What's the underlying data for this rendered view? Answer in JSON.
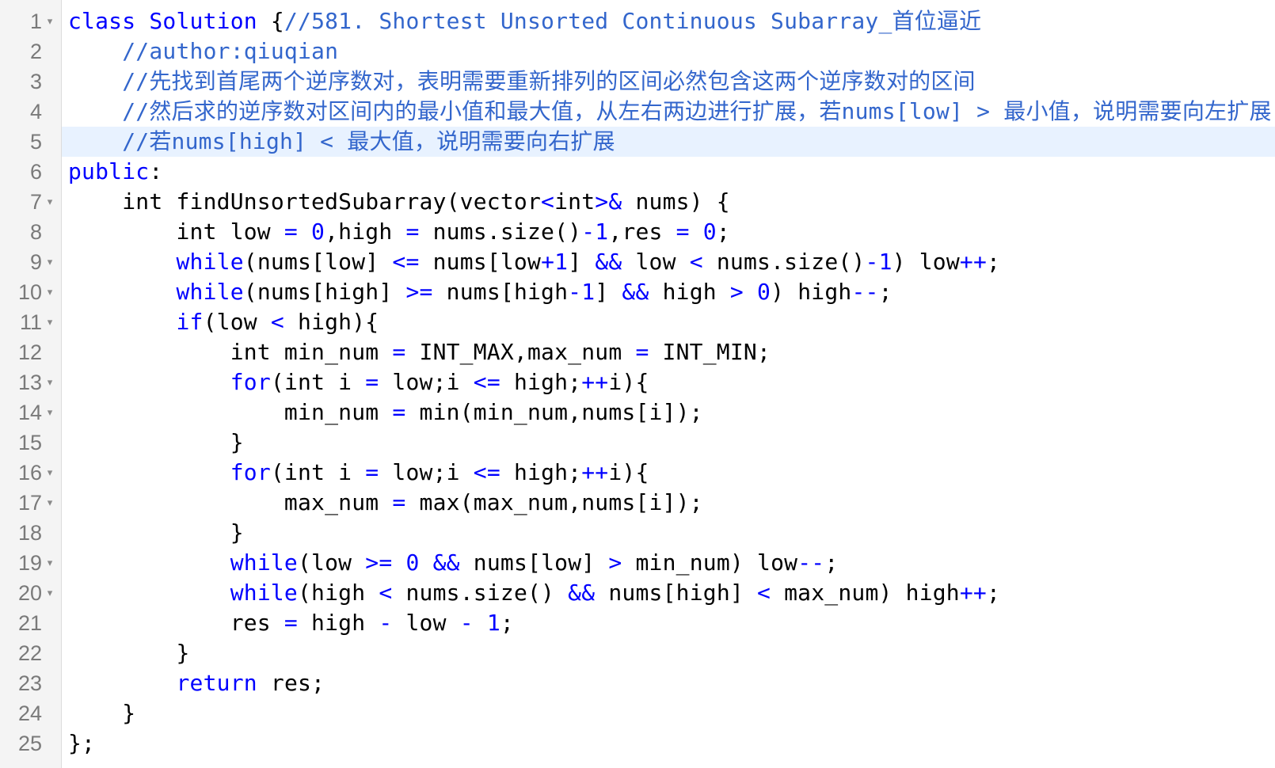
{
  "editor": {
    "active_line": 5,
    "fold_lines": [
      1,
      7,
      9,
      10,
      11,
      13,
      14,
      16,
      17,
      19,
      20
    ],
    "lines": [
      [
        [
          "kw",
          "class "
        ],
        [
          "kw",
          "Solution "
        ],
        [
          "t",
          "{"
        ],
        [
          "cm",
          "//581. Shortest Unsorted Continuous Subarray_首位逼近"
        ]
      ],
      [
        [
          "t",
          "    "
        ],
        [
          "cm",
          "//author:qiuqian"
        ]
      ],
      [
        [
          "t",
          "    "
        ],
        [
          "cm",
          "//先找到首尾两个逆序数对，表明需要重新排列的区间必然包含这两个逆序数对的区间"
        ]
      ],
      [
        [
          "t",
          "    "
        ],
        [
          "cm",
          "//然后求的逆序数对区间内的最小值和最大值，从左右两边进行扩展，若nums[low] > 最小值，说明需要向左扩展"
        ]
      ],
      [
        [
          "t",
          "    "
        ],
        [
          "cm",
          "//若nums[high] < 最大值，说明需要向右扩展"
        ]
      ],
      [
        [
          "kw",
          "public"
        ],
        [
          "t",
          ":"
        ]
      ],
      [
        [
          "t",
          "    int findUnsortedSubarray(vector"
        ],
        [
          "op",
          "<"
        ],
        [
          "t",
          "int"
        ],
        [
          "op",
          ">&"
        ],
        [
          "t",
          " nums) {"
        ]
      ],
      [
        [
          "t",
          "        int low "
        ],
        [
          "op",
          "="
        ],
        [
          "t",
          " "
        ],
        [
          "num",
          "0"
        ],
        [
          "t",
          ",high "
        ],
        [
          "op",
          "="
        ],
        [
          "t",
          " nums.size()"
        ],
        [
          "op",
          "-"
        ],
        [
          "num",
          "1"
        ],
        [
          "t",
          ",res "
        ],
        [
          "op",
          "="
        ],
        [
          "t",
          " "
        ],
        [
          "num",
          "0"
        ],
        [
          "t",
          ";"
        ]
      ],
      [
        [
          "t",
          "        "
        ],
        [
          "kw",
          "while"
        ],
        [
          "t",
          "(nums[low] "
        ],
        [
          "op",
          "<="
        ],
        [
          "t",
          " nums[low"
        ],
        [
          "op",
          "+"
        ],
        [
          "num",
          "1"
        ],
        [
          "t",
          "] "
        ],
        [
          "op",
          "&&"
        ],
        [
          "t",
          " low "
        ],
        [
          "op",
          "<"
        ],
        [
          "t",
          " nums.size()"
        ],
        [
          "op",
          "-"
        ],
        [
          "num",
          "1"
        ],
        [
          "t",
          ") low"
        ],
        [
          "op",
          "++"
        ],
        [
          "t",
          ";"
        ]
      ],
      [
        [
          "t",
          "        "
        ],
        [
          "kw",
          "while"
        ],
        [
          "t",
          "(nums[high] "
        ],
        [
          "op",
          ">="
        ],
        [
          "t",
          " nums[high"
        ],
        [
          "op",
          "-"
        ],
        [
          "num",
          "1"
        ],
        [
          "t",
          "] "
        ],
        [
          "op",
          "&&"
        ],
        [
          "t",
          " high "
        ],
        [
          "op",
          ">"
        ],
        [
          "t",
          " "
        ],
        [
          "num",
          "0"
        ],
        [
          "t",
          ") high"
        ],
        [
          "op",
          "--"
        ],
        [
          "t",
          ";"
        ]
      ],
      [
        [
          "t",
          "        "
        ],
        [
          "kw",
          "if"
        ],
        [
          "t",
          "(low "
        ],
        [
          "op",
          "<"
        ],
        [
          "t",
          " high){"
        ]
      ],
      [
        [
          "t",
          "            int min_num "
        ],
        [
          "op",
          "="
        ],
        [
          "t",
          " INT_MAX,max_num "
        ],
        [
          "op",
          "="
        ],
        [
          "t",
          " INT_MIN;"
        ]
      ],
      [
        [
          "t",
          "            "
        ],
        [
          "kw",
          "for"
        ],
        [
          "t",
          "(int i "
        ],
        [
          "op",
          "="
        ],
        [
          "t",
          " low;i "
        ],
        [
          "op",
          "<="
        ],
        [
          "t",
          " high;"
        ],
        [
          "op",
          "++"
        ],
        [
          "t",
          "i){"
        ]
      ],
      [
        [
          "t",
          "                min_num "
        ],
        [
          "op",
          "="
        ],
        [
          "t",
          " min(min_num,nums[i]);"
        ]
      ],
      [
        [
          "t",
          "            }"
        ]
      ],
      [
        [
          "t",
          "            "
        ],
        [
          "kw",
          "for"
        ],
        [
          "t",
          "(int i "
        ],
        [
          "op",
          "="
        ],
        [
          "t",
          " low;i "
        ],
        [
          "op",
          "<="
        ],
        [
          "t",
          " high;"
        ],
        [
          "op",
          "++"
        ],
        [
          "t",
          "i){"
        ]
      ],
      [
        [
          "t",
          "                max_num "
        ],
        [
          "op",
          "="
        ],
        [
          "t",
          " max(max_num,nums[i]);"
        ]
      ],
      [
        [
          "t",
          "            }"
        ]
      ],
      [
        [
          "t",
          "            "
        ],
        [
          "kw",
          "while"
        ],
        [
          "t",
          "(low "
        ],
        [
          "op",
          ">="
        ],
        [
          "t",
          " "
        ],
        [
          "num",
          "0"
        ],
        [
          "t",
          " "
        ],
        [
          "op",
          "&&"
        ],
        [
          "t",
          " nums[low] "
        ],
        [
          "op",
          ">"
        ],
        [
          "t",
          " min_num) low"
        ],
        [
          "op",
          "--"
        ],
        [
          "t",
          ";"
        ]
      ],
      [
        [
          "t",
          "            "
        ],
        [
          "kw",
          "while"
        ],
        [
          "t",
          "(high "
        ],
        [
          "op",
          "<"
        ],
        [
          "t",
          " nums.size() "
        ],
        [
          "op",
          "&&"
        ],
        [
          "t",
          " nums[high] "
        ],
        [
          "op",
          "<"
        ],
        [
          "t",
          " max_num) high"
        ],
        [
          "op",
          "++"
        ],
        [
          "t",
          ";"
        ]
      ],
      [
        [
          "t",
          "            res "
        ],
        [
          "op",
          "="
        ],
        [
          "t",
          " high "
        ],
        [
          "op",
          "-"
        ],
        [
          "t",
          " low "
        ],
        [
          "op",
          "-"
        ],
        [
          "t",
          " "
        ],
        [
          "num",
          "1"
        ],
        [
          "t",
          ";"
        ]
      ],
      [
        [
          "t",
          "        }"
        ]
      ],
      [
        [
          "t",
          "        "
        ],
        [
          "kw",
          "return"
        ],
        [
          "t",
          " res;"
        ]
      ],
      [
        [
          "t",
          "    }"
        ]
      ],
      [
        [
          "t",
          "};"
        ]
      ]
    ]
  }
}
